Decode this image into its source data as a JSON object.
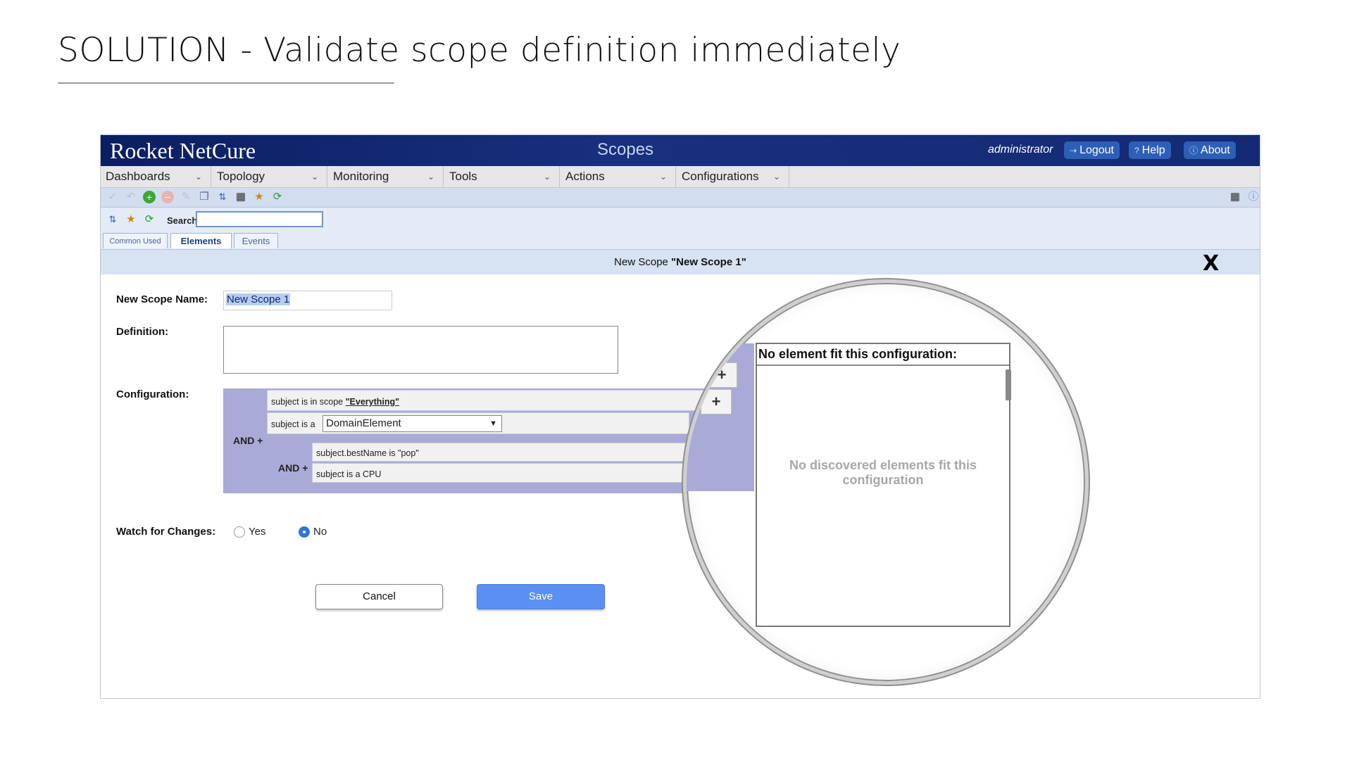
{
  "slide": {
    "title": "SOLUTION - Validate scope definition immediately"
  },
  "app": {
    "brand": "Rocket NetCure",
    "page_title": "Scopes",
    "user": "administrator",
    "links": {
      "logout": "Logout",
      "help": "Help",
      "about": "About"
    }
  },
  "menu": [
    "Dashboards",
    "Topology",
    "Monitoring",
    "Tools",
    "Actions",
    "Configurations"
  ],
  "toolbar": {
    "search_label": "Search",
    "search_value": ""
  },
  "tabs": [
    "Common Used",
    "Elements",
    "Events"
  ],
  "dialog": {
    "title_prefix": "New Scope ",
    "title_name": "\"New Scope 1\"",
    "close": "X",
    "name_label": "New Scope Name:",
    "name_value": "New Scope 1",
    "definition_label": "Definition:",
    "definition_value": "",
    "configuration_label": "Configuration:",
    "config": {
      "and_label": "AND +",
      "rule1_prefix": "subject is in scope ",
      "rule1_link": "\"Everything\"",
      "rule2_prefix": "subject is a",
      "rule2_select": "DomainElement",
      "nested_and_label": "AND +",
      "nested_rule1": "subject.bestName is \"pop\"",
      "nested_rule2": "subject is a CPU",
      "add": "+"
    },
    "watch_label": "Watch for Changes:",
    "watch_options": [
      "Yes",
      "No"
    ],
    "watch_selected": "No",
    "cancel": "Cancel",
    "save": "Save"
  },
  "magnifier": {
    "header": "No element fit this configuration:",
    "message": "No discovered elements fit this configuration"
  },
  "colors": {
    "banner": "#142a74",
    "accent": "#5b8ff0",
    "config_bg": "#a9aad6"
  }
}
